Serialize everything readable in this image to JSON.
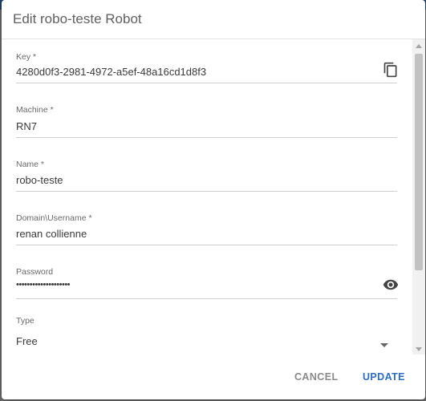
{
  "dialog": {
    "title": "Edit robo-teste Robot"
  },
  "fields": {
    "key": {
      "label": "Key *",
      "value": "4280d0f3-2981-4972-a5ef-48a16cd1d8f3",
      "icon": "copy-icon"
    },
    "machine": {
      "label": "Machine *",
      "value": "RN7"
    },
    "name": {
      "label": "Name *",
      "value": "robo-teste"
    },
    "username": {
      "label": "Domain\\Username *",
      "value": "renan collienne"
    },
    "password": {
      "label": "Password",
      "value": "••••••••••••••••••••",
      "icon": "eye-icon"
    },
    "type": {
      "label": "Type",
      "value": "Free",
      "icon": "dropdown-arrow-icon"
    }
  },
  "actions": {
    "cancel_label": "CANCEL",
    "update_label": "UPDATE"
  },
  "colors": {
    "accent": "#2d6dbb",
    "header": "#1f3f66",
    "icon": "#444444"
  }
}
